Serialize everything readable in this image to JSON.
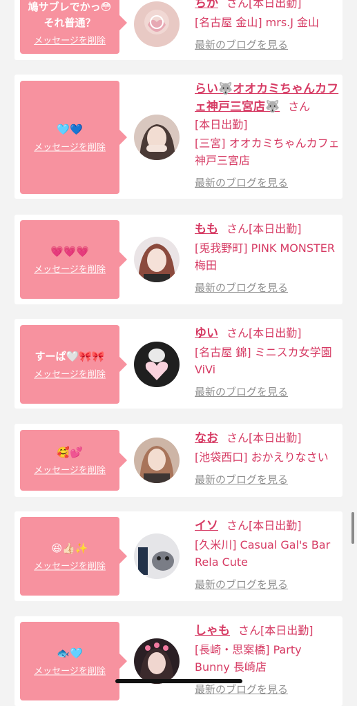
{
  "cards": [
    {
      "message": "鳩サブレでかっ😳 それ普通？",
      "delete_label": "メッセージを削除",
      "name": "ちか",
      "suffix": "さん",
      "status": "[本日出勤]",
      "shop": "[名古屋 金山] mrs.J 金山",
      "blog_label": "最新のブログを見る"
    },
    {
      "message": "🩵💙",
      "delete_label": "メッセージを削除",
      "name": "らい🐺オオカミちゃんカフェ神戸三宮店🐺",
      "suffix": "さん",
      "status": "[本日出勤]",
      "shop": "[三宮] オオカミちゃんカフェ神戸三宮店",
      "blog_label": "最新のブログを見る"
    },
    {
      "message": "💗💗💗",
      "delete_label": "メッセージを削除",
      "name": "もも",
      "suffix": "さん",
      "status": "[本日出勤]",
      "shop": "[兎我野町] PINK MONSTER梅田",
      "blog_label": "最新のブログを見る"
    },
    {
      "message": "すーぱ🤍🎀🎀",
      "delete_label": "メッセージを削除",
      "name": "ゆい",
      "suffix": "さん",
      "status": "[本日出勤]",
      "shop": "[名古屋 錦] ミニスカ女学園ViVi",
      "blog_label": "最新のブログを見る"
    },
    {
      "message": "🥰💕",
      "delete_label": "メッセージを削除",
      "name": "なお",
      "suffix": "さん",
      "status": "[本日出勤]",
      "shop": "[池袋西口] おかえりなさい",
      "blog_label": "最新のブログを見る"
    },
    {
      "message": "😆👍🏻✨",
      "delete_label": "メッセージを削除",
      "name": "イソ",
      "suffix": "さん",
      "status": "[本日出勤]",
      "shop": "[久米川] Casual Gal's Bar Rela Cute",
      "blog_label": "最新のブログを見る"
    },
    {
      "message": "🐟🩵",
      "delete_label": "メッセージを削除",
      "name": "しゃも",
      "suffix": "さん",
      "status": "[本日出勤]",
      "shop": "[長崎・思案橋] Party Bunny 長崎店",
      "blog_label": "最新のブログを見る"
    }
  ],
  "colors": {
    "accent": "#d63a63",
    "bubble": "#f7929f",
    "background": "#f3f3f3",
    "link_gray": "#909090"
  }
}
